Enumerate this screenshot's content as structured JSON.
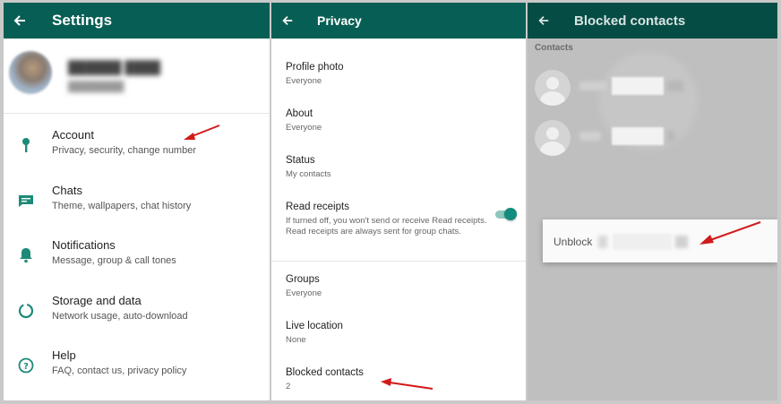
{
  "settings": {
    "title": "Settings",
    "items": [
      {
        "title": "Account",
        "subtitle": "Privacy, security, change number",
        "icon": "key-icon"
      },
      {
        "title": "Chats",
        "subtitle": "Theme, wallpapers, chat history",
        "icon": "chat-icon"
      },
      {
        "title": "Notifications",
        "subtitle": "Message, group & call tones",
        "icon": "bell-icon"
      },
      {
        "title": "Storage and data",
        "subtitle": "Network usage, auto-download",
        "icon": "storage-icon"
      },
      {
        "title": "Help",
        "subtitle": "FAQ, contact us, privacy policy",
        "icon": "help-icon"
      }
    ]
  },
  "privacy": {
    "title": "Privacy",
    "items": [
      {
        "title": "Profile photo",
        "value": "Everyone"
      },
      {
        "title": "About",
        "value": "Everyone"
      },
      {
        "title": "Status",
        "value": "My contacts"
      },
      {
        "title": "Read receipts",
        "value": "If turned off, you won't send or receive Read receipts. Read receipts are always sent for group chats.",
        "toggle_on": true
      },
      {
        "title": "Groups",
        "value": "Everyone"
      },
      {
        "title": "Live location",
        "value": "None"
      },
      {
        "title": "Blocked contacts",
        "value": "2"
      }
    ]
  },
  "blocked": {
    "title": "Blocked contacts",
    "section": "Contacts",
    "menu_label": "Unblock"
  },
  "colors": {
    "header": "#075e54",
    "accent": "#128c7e",
    "arrow": "#d11a1a"
  }
}
